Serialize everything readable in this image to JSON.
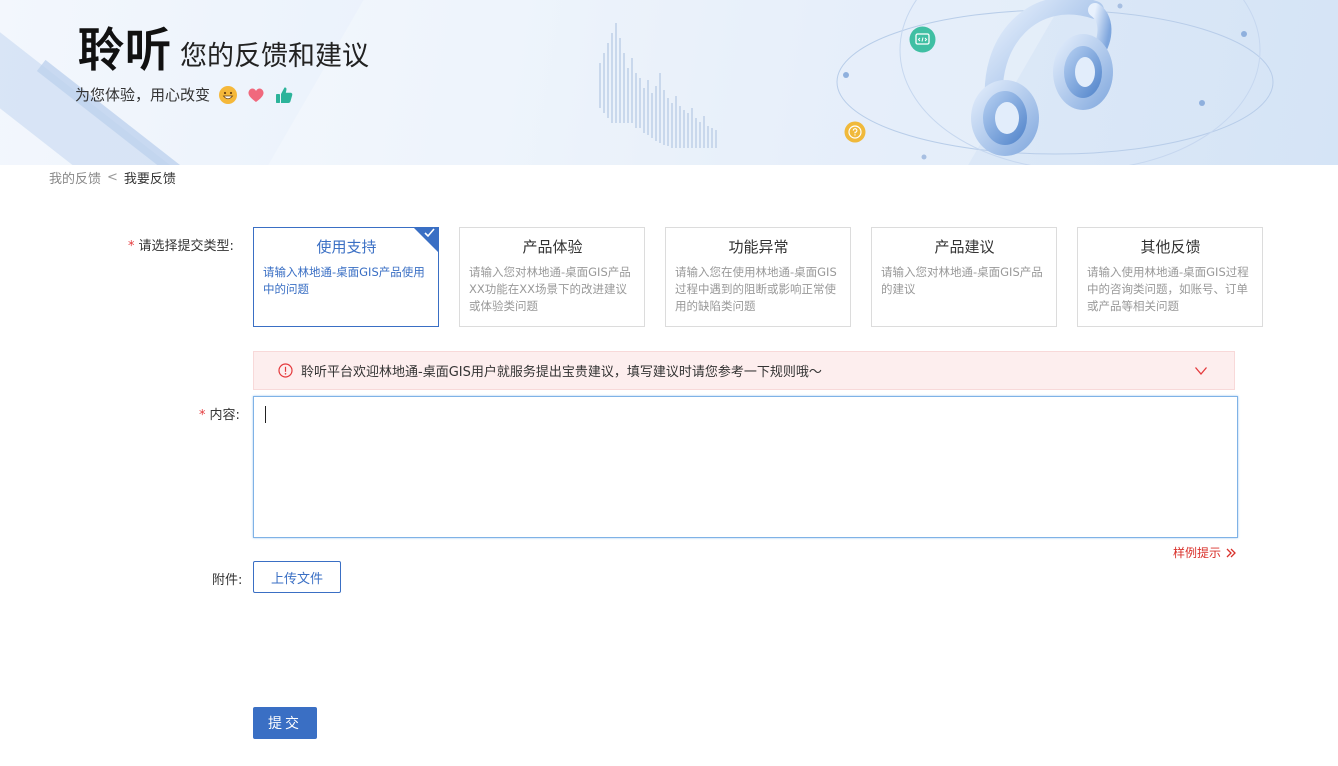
{
  "banner": {
    "title_main": "聆听",
    "title_sub": "您的反馈和建议",
    "slogan": "为您体验，用心改变",
    "emoji_icons": [
      "smile-face-icon",
      "heart-icon",
      "thumbs-up-icon"
    ]
  },
  "breadcrumb": {
    "parent": "我的反馈",
    "separator": "<",
    "current": "我要反馈"
  },
  "form": {
    "type_label": "请选择提交类型:",
    "required_mark": "*",
    "types": [
      {
        "title": "使用支持",
        "desc": "请输入林地通-桌面GIS产品使用中的问题",
        "selected": true
      },
      {
        "title": "产品体验",
        "desc": "请输入您对林地通-桌面GIS产品XX功能在XX场景下的改进建议或体验类问题",
        "selected": false
      },
      {
        "title": "功能异常",
        "desc": "请输入您在使用林地通-桌面GIS过程中遇到的阻断或影响正常使用的缺陷类问题",
        "selected": false
      },
      {
        "title": "产品建议",
        "desc": "请输入您对林地通-桌面GIS产品的建议",
        "selected": false
      },
      {
        "title": "其他反馈",
        "desc": "请输入使用林地通-桌面GIS过程中的咨询类问题，如账号、订单或产品等相关问题",
        "selected": false
      }
    ],
    "notice": "聆听平台欢迎林地通-桌面GIS用户就服务提出宝贵建议，填写建议时请您参考一下规则哦～",
    "content_label": "内容:",
    "content_value": "",
    "example_hint": "样例提示",
    "attachment_label": "附件:",
    "upload_label": "上传文件",
    "submit_label": "提交"
  },
  "colors": {
    "accent": "#3a6fc4",
    "required": "#e4393c",
    "notice_bg": "#fdeeee",
    "hint": "#d9312b"
  }
}
